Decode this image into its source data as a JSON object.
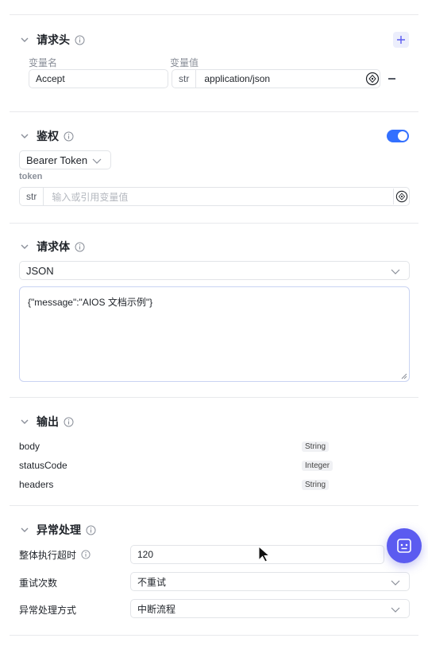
{
  "headers_section": {
    "title": "请求头",
    "col_name_label": "变量名",
    "col_value_label": "变量值",
    "row": {
      "name": "Accept",
      "type": "str",
      "value": "application/json"
    }
  },
  "auth_section": {
    "title": "鉴权",
    "enabled": true,
    "auth_type": "Bearer Token",
    "token_label": "token",
    "token_type": "str",
    "token_placeholder": "输入或引用变量值"
  },
  "body_section": {
    "title": "请求体",
    "format": "JSON",
    "content": "{\"message\":\"AIOS 文档示例\"}"
  },
  "output_section": {
    "title": "输出",
    "fields": [
      {
        "name": "body",
        "type": "String"
      },
      {
        "name": "statusCode",
        "type": "Integer"
      },
      {
        "name": "headers",
        "type": "String"
      }
    ]
  },
  "error_section": {
    "title": "异常处理",
    "timeout_label": "整体执行超时",
    "timeout_value": "120",
    "retry_label": "重试次数",
    "retry_value": "不重试",
    "handling_label": "异常处理方式",
    "handling_value": "中断流程"
  },
  "colors": {
    "accent": "#3370ff",
    "fab": "#5b5bf0",
    "border": "#e2e4e8"
  }
}
